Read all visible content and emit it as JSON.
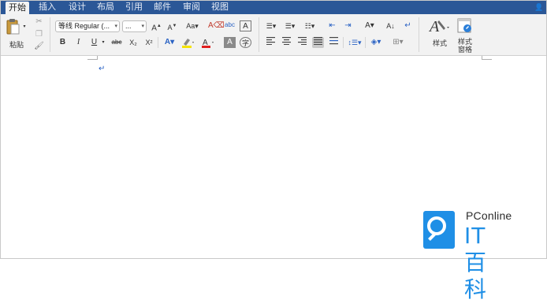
{
  "tabs": [
    {
      "label": "开始",
      "active": true
    },
    {
      "label": "插入"
    },
    {
      "label": "设计"
    },
    {
      "label": "布局"
    },
    {
      "label": "引用"
    },
    {
      "label": "邮件"
    },
    {
      "label": "审阅"
    },
    {
      "label": "视图"
    }
  ],
  "clipboard": {
    "paste_label": "粘贴"
  },
  "font": {
    "family": "等线 Regular (...",
    "size": "..."
  },
  "format_buttons": {
    "bold": "B",
    "italic": "I",
    "underline": "U",
    "strike": "abc",
    "subscript": "X₂",
    "superscript": "X²"
  },
  "styles": {
    "styles_label": "样式",
    "pane_label_1": "样式",
    "pane_label_2": "窗格"
  },
  "document": {
    "paragraph_mark": "↵"
  },
  "watermark": {
    "brand": "PConline",
    "name": "IT百科"
  },
  "colors": {
    "tabbar": "#2b5797",
    "ribbon": "#f2f2f2",
    "font_color": "#e02020",
    "highlight": "#f5e400",
    "accent": "#1f8fe6"
  }
}
